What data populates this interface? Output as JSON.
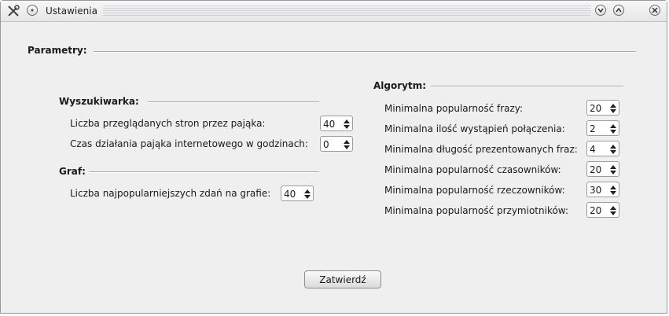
{
  "window": {
    "title": "Ustawienia",
    "tools_icon": "tools-icon",
    "menu_icon": "window-menu-icon",
    "minimize_icon": "chevron-down-icon",
    "maximize_icon": "chevron-up-icon",
    "close_icon": "close-icon"
  },
  "parameters": {
    "title": "Parametry:"
  },
  "search": {
    "title": "Wyszukiwarka:",
    "pages_label": "Liczba przeglądanych stron przez pająka:",
    "pages_value": "40",
    "hours_label": "Czas działania pająka internetowego w godzinach:",
    "hours_value": "0"
  },
  "graph": {
    "title": "Graf:",
    "sentences_label": "Liczba najpopularniejszych zdań na grafie:",
    "sentences_value": "40"
  },
  "algorithm": {
    "title": "Algorytm:",
    "rows": [
      {
        "label": "Minimalna popularność frazy:",
        "value": "20"
      },
      {
        "label": "Minimalna ilość wystąpień połączenia:",
        "value": "2"
      },
      {
        "label": "Minimalna długość prezentowanych fraz:",
        "value": "4"
      },
      {
        "label": "Minimalna popularność czasowników:",
        "value": "20"
      },
      {
        "label": "Minimalna popularność rzeczowników:",
        "value": "30"
      },
      {
        "label": "Minimalna popularność przymiotników:",
        "value": "20"
      }
    ]
  },
  "confirm_button": "Zatwierdź"
}
